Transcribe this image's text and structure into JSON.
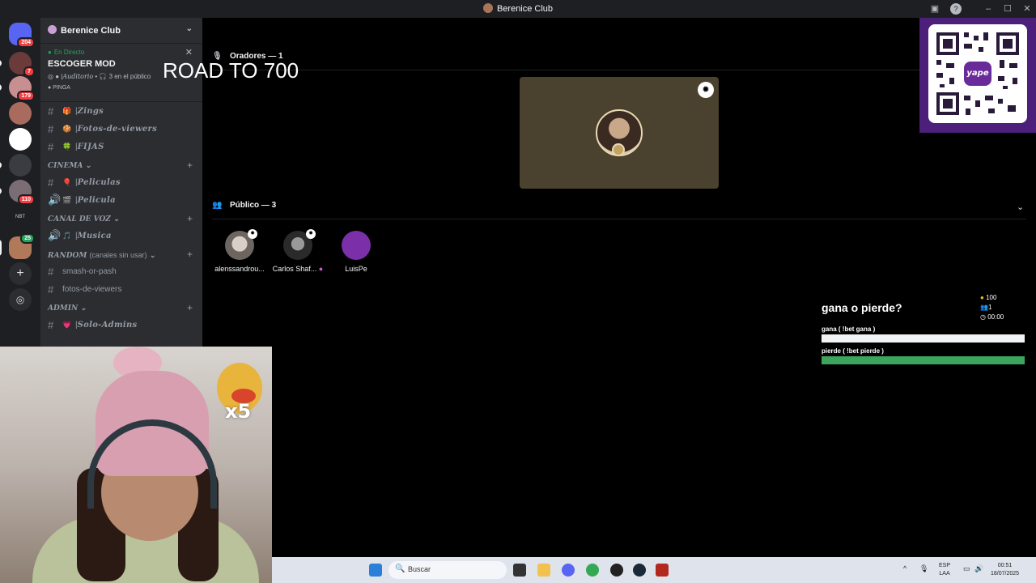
{
  "window": {
    "title": "Berenice Club"
  },
  "guild_badges": [
    "204",
    "7",
    "179",
    "110",
    "25"
  ],
  "sidebar": {
    "server_name": "Berenice Club",
    "live": {
      "status": "En Directo",
      "title": "ESCOGER MOD",
      "stage": "Auditorio",
      "audience": "3 en el público",
      "user": "PINGA"
    },
    "channels_top": [
      {
        "emoji": "🎁",
        "name": "Zings"
      },
      {
        "emoji": "🍪",
        "name": "Fotos-de-viewers"
      },
      {
        "emoji": "🍀",
        "name": "FIJAS"
      }
    ],
    "cat_cinema": "CINEMA",
    "cinema": [
      {
        "emoji": "🎈",
        "name": "Peliculas",
        "type": "#"
      },
      {
        "emoji": "🎬",
        "name": "Pelicula",
        "type": "voice"
      }
    ],
    "cat_voice": "CANAL DE VOZ",
    "voice": [
      {
        "emoji": "🎵",
        "name": "Musica"
      }
    ],
    "cat_random": "RANDOM",
    "cat_random_note": "(canales sin usar)",
    "random": [
      "smash-or-pash",
      "fotos-de-viewers"
    ],
    "cat_admin": "ADMIN",
    "admin": [
      {
        "emoji": "💗",
        "name": "Solo-Admins"
      }
    ]
  },
  "overlay": {
    "road": "ROAD TO 700"
  },
  "stage": {
    "speakers_label": "Oradores — 1",
    "audience_label": "Público — 3",
    "audience": [
      {
        "name": "alenssandrou..."
      },
      {
        "name": "Carlos Shaf..."
      },
      {
        "name": "LuisPe"
      }
    ]
  },
  "qr": {
    "brand": "yape"
  },
  "bet": {
    "question": "gana o pierde?",
    "coins": "100",
    "users": "1",
    "time": "00:00",
    "options": [
      {
        "label": "gana ( !bet gana )",
        "fill": 0
      },
      {
        "label": "pierde ( !bet pierde )",
        "fill": 1
      }
    ]
  },
  "webcam": {
    "overlay": "x5"
  },
  "taskbar": {
    "search_placeholder": "Buscar",
    "lang1": "ESP",
    "lang2": "LAA",
    "time": "00:51",
    "date": "18/07/2025"
  },
  "colors": {
    "bar_empty": "#f2f3f5",
    "bar_full": "#3ba55d",
    "qr_bg": "#4b1f7a"
  }
}
